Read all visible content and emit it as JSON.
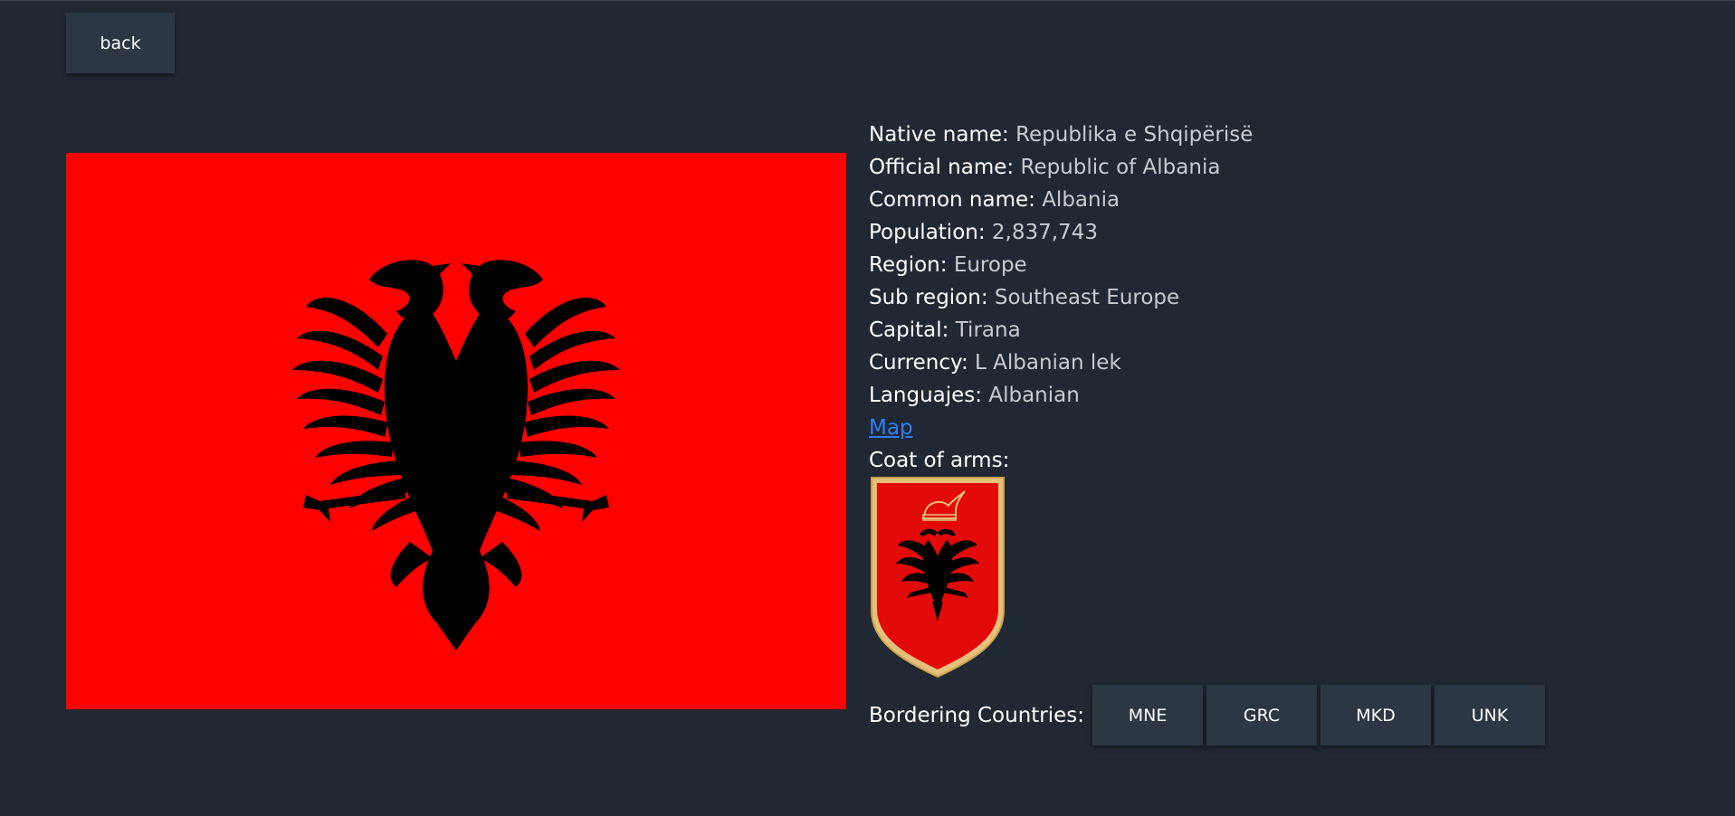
{
  "back_button": {
    "label": "back"
  },
  "flag": {
    "icon": "albania-flag-icon",
    "color": "#ff0000"
  },
  "details": {
    "native_name": {
      "label": "Native name:",
      "value": "Republika e Shqipërisë"
    },
    "official_name": {
      "label": "Official name:",
      "value": "Republic of Albania"
    },
    "common_name": {
      "label": "Common name:",
      "value": "Albania"
    },
    "population": {
      "label": "Population:",
      "value": "2,837,743"
    },
    "region": {
      "label": "Region:",
      "value": "Europe"
    },
    "sub_region": {
      "label": "Sub region:",
      "value": "Southeast Europe"
    },
    "capital": {
      "label": "Capital:",
      "value": "Tirana"
    },
    "currency": {
      "label": "Currency:",
      "value": "L Albanian lek"
    },
    "languages": {
      "label": "Languajes:",
      "value": "Albanian"
    },
    "map_link": "Map",
    "coat_of_arms_label": "Coat of arms:"
  },
  "coat_of_arms": {
    "icon": "albania-coat-of-arms-icon"
  },
  "borders": {
    "label": "Bordering Countries:",
    "countries": [
      "MNE",
      "GRC",
      "MKD",
      "UNK"
    ]
  },
  "colors": {
    "background": "#202833",
    "button": "#2b3743",
    "link": "#2f7ef2",
    "value_text": "#c8cbd0"
  }
}
